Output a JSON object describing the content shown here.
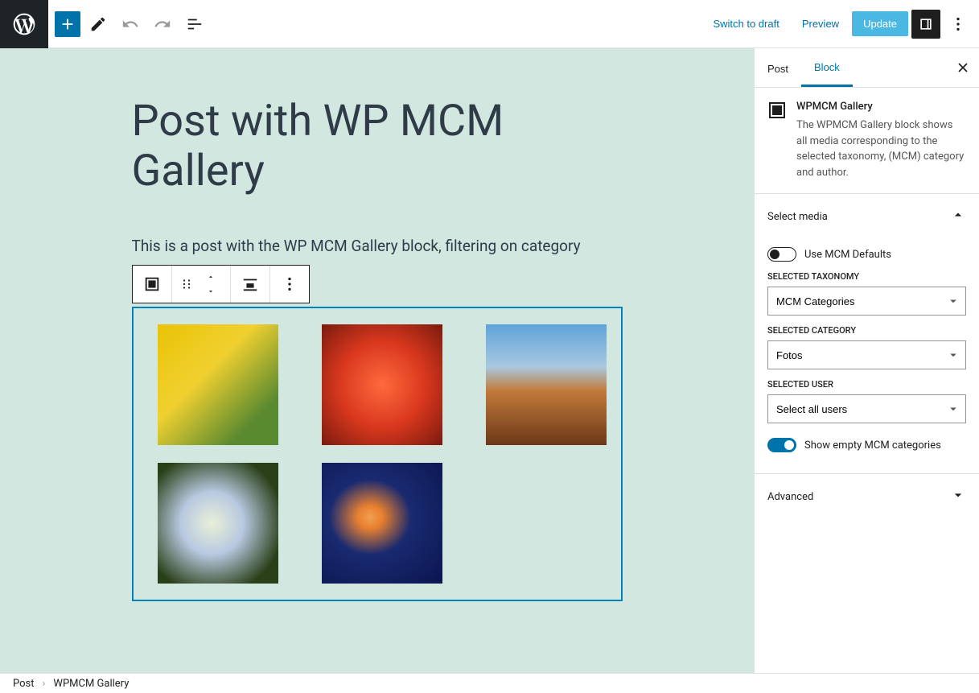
{
  "topbar": {
    "switch_to_draft": "Switch to draft",
    "preview": "Preview",
    "update": "Update"
  },
  "editor": {
    "post_title": "Post with WP MCM Gallery",
    "paragraph": "This is a post with the WP MCM Gallery block, filtering on category"
  },
  "sidebar": {
    "tabs": {
      "post": "Post",
      "block": "Block"
    },
    "block_info": {
      "title": "WPMCM Gallery",
      "description": "The WPMCM Gallery block shows all media corresponding to the selected taxonomy, (MCM) category and author."
    },
    "select_media": {
      "title": "Select media",
      "use_defaults_label": "Use MCM Defaults",
      "use_defaults_on": false,
      "taxonomy_label": "SELECTED TAXONOMY",
      "taxonomy_value": "MCM Categories",
      "category_label": "SELECTED CATEGORY",
      "category_value": "Fotos",
      "user_label": "SELECTED USER",
      "user_value": "Select all users",
      "show_empty_label": "Show empty MCM categories",
      "show_empty_on": true
    },
    "advanced": {
      "title": "Advanced"
    }
  },
  "breadcrumb": {
    "root": "Post",
    "current": "WPMCM Gallery"
  }
}
